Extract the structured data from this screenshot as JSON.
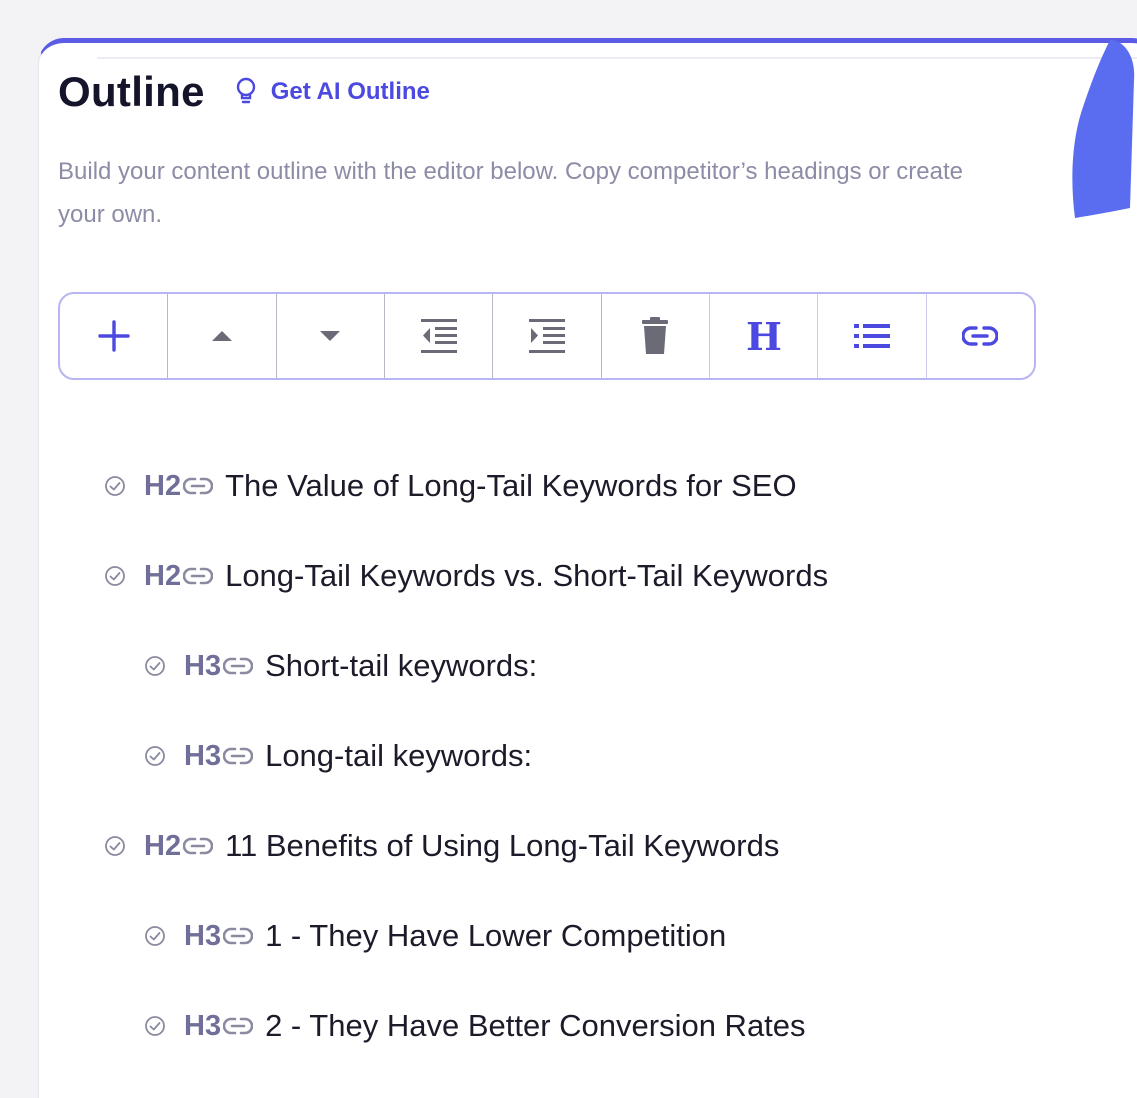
{
  "panel": {
    "title": "Outline",
    "ai_outline_label": "Get AI Outline",
    "description": "Build your content outline with the editor below. Copy competitor’s headings or create your own."
  },
  "toolbar": {
    "buttons": [
      {
        "name": "add-button",
        "icon": "plus-icon"
      },
      {
        "name": "move-up-button",
        "icon": "caret-up-icon"
      },
      {
        "name": "move-down-button",
        "icon": "caret-down-icon"
      },
      {
        "name": "outdent-button",
        "icon": "outdent-icon"
      },
      {
        "name": "indent-button",
        "icon": "indent-icon"
      },
      {
        "name": "delete-button",
        "icon": "trash-icon"
      },
      {
        "name": "heading-button",
        "icon": "heading-icon"
      },
      {
        "name": "list-button",
        "icon": "list-icon"
      },
      {
        "name": "link-button",
        "icon": "link-icon"
      }
    ],
    "accent_color": "#4b49e0"
  },
  "outline": {
    "items": [
      {
        "level": "H2",
        "text": "The Value of Long-Tail Keywords for SEO"
      },
      {
        "level": "H2",
        "text": "Long-Tail Keywords vs. Short-Tail Keywords"
      },
      {
        "level": "H3",
        "text": "Short-tail keywords:"
      },
      {
        "level": "H3",
        "text": "Long-tail keywords:"
      },
      {
        "level": "H2",
        "text": "11 Benefits of Using Long-Tail Keywords"
      },
      {
        "level": "H3",
        "text": "1 - They Have Lower Competition"
      },
      {
        "level": "H3",
        "text": "2 - They Have Better Conversion Rates"
      }
    ]
  }
}
